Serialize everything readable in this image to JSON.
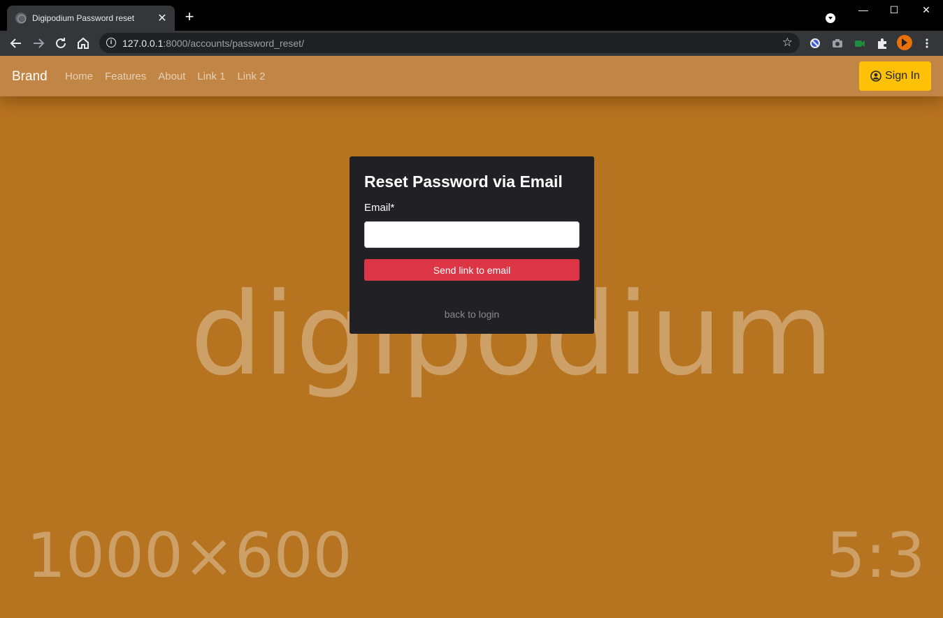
{
  "browser": {
    "tab_title": "Digipodium Password reset",
    "tab_close": "✕",
    "new_tab": "+",
    "url_host": "127.0.0.1",
    "url_rest": ":8000/accounts/password_reset/",
    "window_controls": {
      "minimize": "—",
      "maximize": "☐",
      "close": "✕"
    }
  },
  "navbar": {
    "brand": "Brand",
    "links": [
      "Home",
      "Features",
      "About",
      "Link 1",
      "Link 2"
    ],
    "signin_label": "Sign In"
  },
  "background": {
    "watermark": "digipodium",
    "size_text": "1000×600",
    "ratio_text": "5:3"
  },
  "form": {
    "title": "Reset Password via Email",
    "email_label": "Email*",
    "email_value": "",
    "submit_label": "Send link to email",
    "back_link": "back to login"
  },
  "colors": {
    "page_bg": "#b67320",
    "navbar_bg": "#c18645",
    "card_bg": "#212024",
    "submit_bg": "#dc3545",
    "signin_bg": "#ffc107"
  }
}
